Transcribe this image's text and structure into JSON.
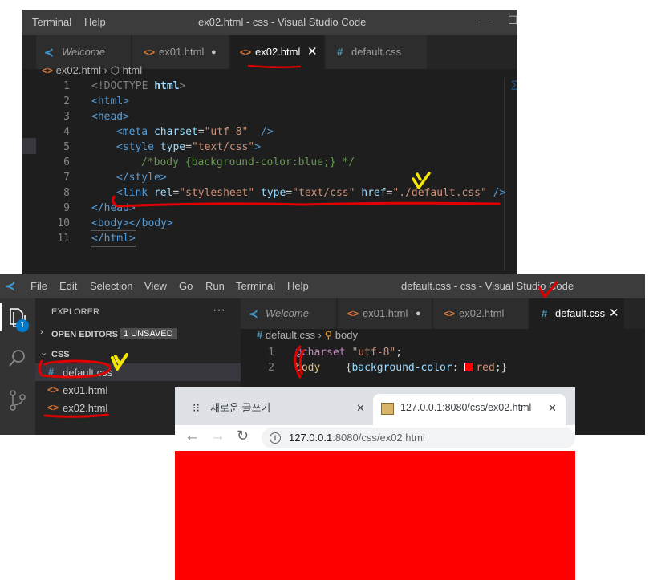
{
  "window1": {
    "menu": [
      "Terminal",
      "Help"
    ],
    "title": "ex02.html - css - Visual Studio Code",
    "tabs": [
      {
        "icon": "vscode-icon",
        "label": "Welcome"
      },
      {
        "icon": "html-icon",
        "label": "ex01.html",
        "dirty": true
      },
      {
        "icon": "html-icon",
        "label": "ex02.html",
        "active": true
      },
      {
        "icon": "css-icon",
        "label": "default.css"
      }
    ],
    "breadcrumb": {
      "file": "ex02.html",
      "node": "html"
    },
    "line_numbers": [
      "1",
      "2",
      "3",
      "4",
      "5",
      "6",
      "7",
      "8",
      "9",
      "10",
      "11"
    ],
    "code": {
      "l1_doctype": "<!DOCTYPE ",
      "l1_html": "html",
      "l1_close": ">",
      "l2": "<html>",
      "l3": "<head>",
      "l4_open": "<meta ",
      "l4_attr": "charset",
      "l4_eq": "=",
      "l4_val": "\"utf-8\"",
      "l4_close": "  />",
      "l5_open": "<style ",
      "l5_attr": "type",
      "l5_eq": "=",
      "l5_val": "\"text/css\"",
      "l5_close": ">",
      "l6_comment": "/*body {background-color:blue;} */",
      "l7": "</style>",
      "l8_open": "<link ",
      "l8_a1": "rel",
      "l8_v1": "\"stylesheet\"",
      "l8_a2": "type",
      "l8_v2": "\"text/css\"",
      "l8_a3": "href",
      "l8_v3": "\"./default.css\"",
      "l8_close": " />",
      "l9": "</head>",
      "l10": "<body></body>",
      "l11": "</html>",
      "eq": "="
    }
  },
  "window2": {
    "menu": [
      "File",
      "Edit",
      "Selection",
      "View",
      "Go",
      "Run",
      "Terminal",
      "Help"
    ],
    "title": "default.css - css - Visual Studio Code",
    "explorer": {
      "title": "EXPLORER",
      "more": "···",
      "open_editors": "OPEN EDITORS",
      "unsaved": "1 UNSAVED",
      "folder": "CSS",
      "files": [
        {
          "icon": "css-icon",
          "label": "default.css"
        },
        {
          "icon": "html-icon",
          "label": "ex01.html"
        },
        {
          "icon": "html-icon",
          "label": "ex02.html"
        }
      ],
      "badge": "1"
    },
    "tabs": [
      {
        "icon": "vscode-icon",
        "label": "Welcome"
      },
      {
        "icon": "html-icon",
        "label": "ex01.html",
        "dirty": true
      },
      {
        "icon": "html-icon",
        "label": "ex02.html"
      },
      {
        "icon": "css-icon",
        "label": "default.css",
        "active": true
      }
    ],
    "breadcrumb": {
      "file": "default.css",
      "node": "body"
    },
    "line_numbers": [
      "1",
      "2"
    ],
    "code": {
      "l1_at": "@charset",
      "l1_str": " \"utf-8\"",
      "l1_semi": ";",
      "l2_sel": "body",
      "l2_open": "    {",
      "l2_prop": "background-color",
      "l2_colon": ": ",
      "l2_val": "red",
      "l2_close": ";}",
      "swatch_color": "#ff0000"
    }
  },
  "browser": {
    "tabs": [
      {
        "icon": "dots-icon",
        "label": "새로운 글쓰기"
      },
      {
        "icon": "page-icon",
        "label": "127.0.0.1:8080/css/ex02.html",
        "active": true
      }
    ],
    "url_host": "127.0.0.1",
    "url_rest": ":8080/css/ex02.html",
    "page_background": "#ff0000"
  },
  "colors": {
    "vscode_bg": "#1e1e1e",
    "annotation_red": "#e00000",
    "annotation_yellow": "#f5e600"
  }
}
